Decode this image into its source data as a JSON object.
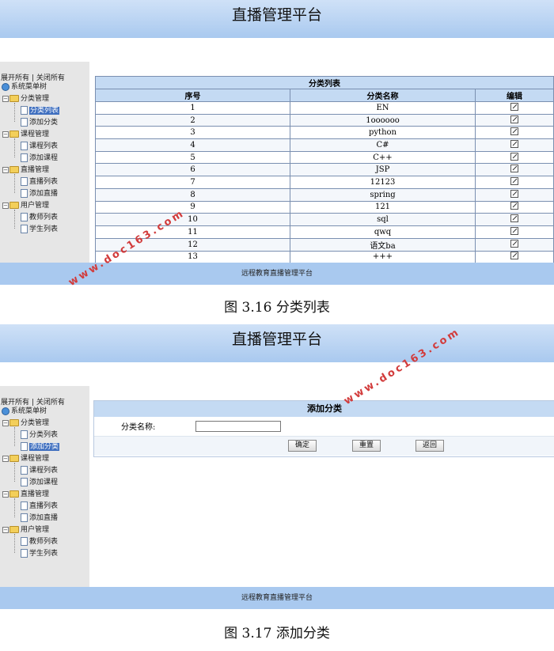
{
  "header_title": "直播管理平台",
  "sidebar": {
    "expand_all": "展开所有",
    "separator": "|",
    "collapse_all": "关闭所有",
    "root": "系统菜单树",
    "groups": [
      {
        "label": "分类管理",
        "items": [
          "分类列表",
          "添加分类"
        ]
      },
      {
        "label": "课程管理",
        "items": [
          "课程列表",
          "添加课程"
        ]
      },
      {
        "label": "直播管理",
        "items": [
          "直播列表",
          "添加直播"
        ]
      },
      {
        "label": "用户管理",
        "items": [
          "教师列表",
          "学生列表"
        ]
      }
    ]
  },
  "figure1": {
    "table_title": "分类列表",
    "columns": [
      "序号",
      "分类名称",
      "编辑"
    ],
    "rows": [
      [
        "1",
        "EN"
      ],
      [
        "2",
        "1oooooo"
      ],
      [
        "3",
        "python"
      ],
      [
        "4",
        "C#"
      ],
      [
        "5",
        "C++"
      ],
      [
        "6",
        "JSP"
      ],
      [
        "7",
        "12123"
      ],
      [
        "8",
        "spring"
      ],
      [
        "9",
        "121"
      ],
      [
        "10",
        "sql"
      ],
      [
        "11",
        "qwq"
      ],
      [
        "12",
        "语文ba"
      ],
      [
        "13",
        "+++"
      ]
    ],
    "footer": "远程教育直播管理平台",
    "caption": "图 3.16  分类列表"
  },
  "figure2": {
    "form_title": "添加分类",
    "field_label": "分类名称:",
    "field_value": "",
    "buttons": {
      "confirm": "确定",
      "reset": "重置",
      "back": "返回"
    },
    "footer": "远程教育直播管理平台",
    "caption": "图 3.17  添加分类"
  },
  "watermark": "www.doc163.com"
}
